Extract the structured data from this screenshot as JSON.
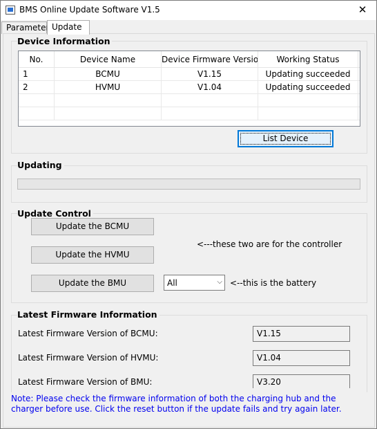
{
  "window": {
    "title": "BMS Online Update Software  V1.5",
    "close_glyph": "✕"
  },
  "tabs": [
    {
      "label": "Parameter",
      "active": false
    },
    {
      "label": "Update",
      "active": true
    }
  ],
  "device_info": {
    "title": "Device Information",
    "columns": [
      "No.",
      "Device Name",
      "Device Firmware Version",
      "Working Status"
    ],
    "rows": [
      {
        "no": "1",
        "name": "BCMU",
        "version": "V1.15",
        "status": "Updating succeeded"
      },
      {
        "no": "2",
        "name": "HVMU",
        "version": "V1.04",
        "status": "Updating succeeded"
      }
    ],
    "list_button": "List Device"
  },
  "updating": {
    "title": "Updating",
    "progress_percent": 0
  },
  "update_control": {
    "title": "Update Control",
    "bcmu_button": "Update the BCMU",
    "hvmu_button": "Update the HVMU",
    "bmu_button": "Update the BMU",
    "controller_note": "<---these two are for the controller",
    "bmu_select_value": "All",
    "battery_note": "<--this is the battery"
  },
  "latest_firmware": {
    "title": "Latest Firmware Information",
    "bcmu_label": "Latest Firmware Version of BCMU:",
    "bcmu_value": "V1.15",
    "hvmu_label": "Latest Firmware Version of HVMU:",
    "hvmu_value": "V1.04",
    "bmu_label": "Latest Firmware Version of BMU:",
    "bmu_value": "V3.20"
  },
  "note": "Note: Please check the firmware information of both the charging hub and the charger before use. Click the reset button if the update fails and try again later.",
  "colors": {
    "note_text": "#0000ee",
    "default_button_border": "#0078d7"
  },
  "icons": {
    "app": "app-window-icon",
    "close": "close-icon",
    "dropdown": "chevron-down-icon"
  }
}
